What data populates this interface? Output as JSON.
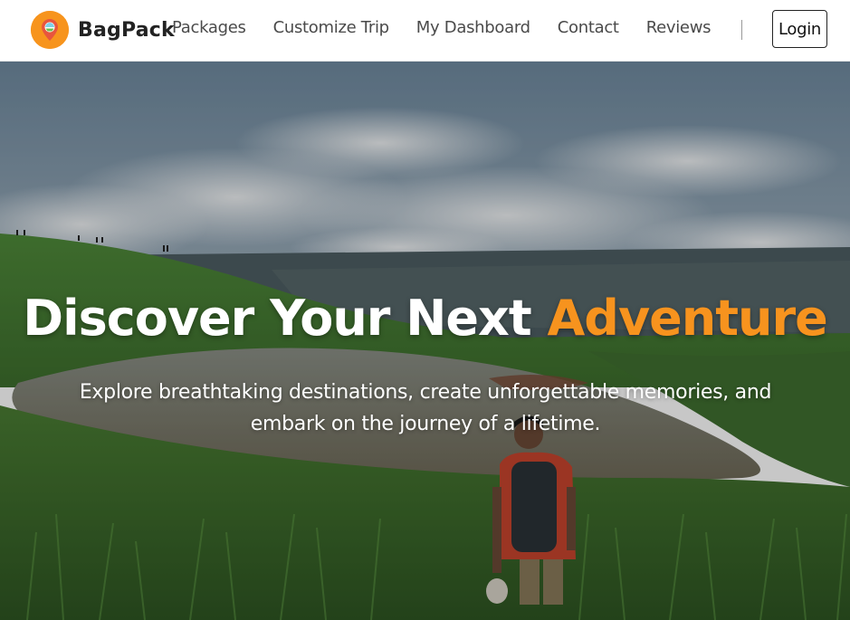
{
  "brand": {
    "name": "BagPack"
  },
  "nav": {
    "links": [
      "Packages",
      "Customize Trip",
      "My Dashboard",
      "Contact",
      "Reviews"
    ],
    "separator": "|",
    "login_label": "Login"
  },
  "hero": {
    "title_main": "Discover Your Next",
    "title_accent": "Adventure",
    "subtitle": "Explore breathtaking destinations, create unforgettable memories, and embark on the journey of a lifetime."
  },
  "colors": {
    "accent": "#f7931e",
    "nav_text": "#4a4a4a",
    "brand_text": "#222222"
  },
  "icons": {
    "logo": "map-pin-icon"
  }
}
